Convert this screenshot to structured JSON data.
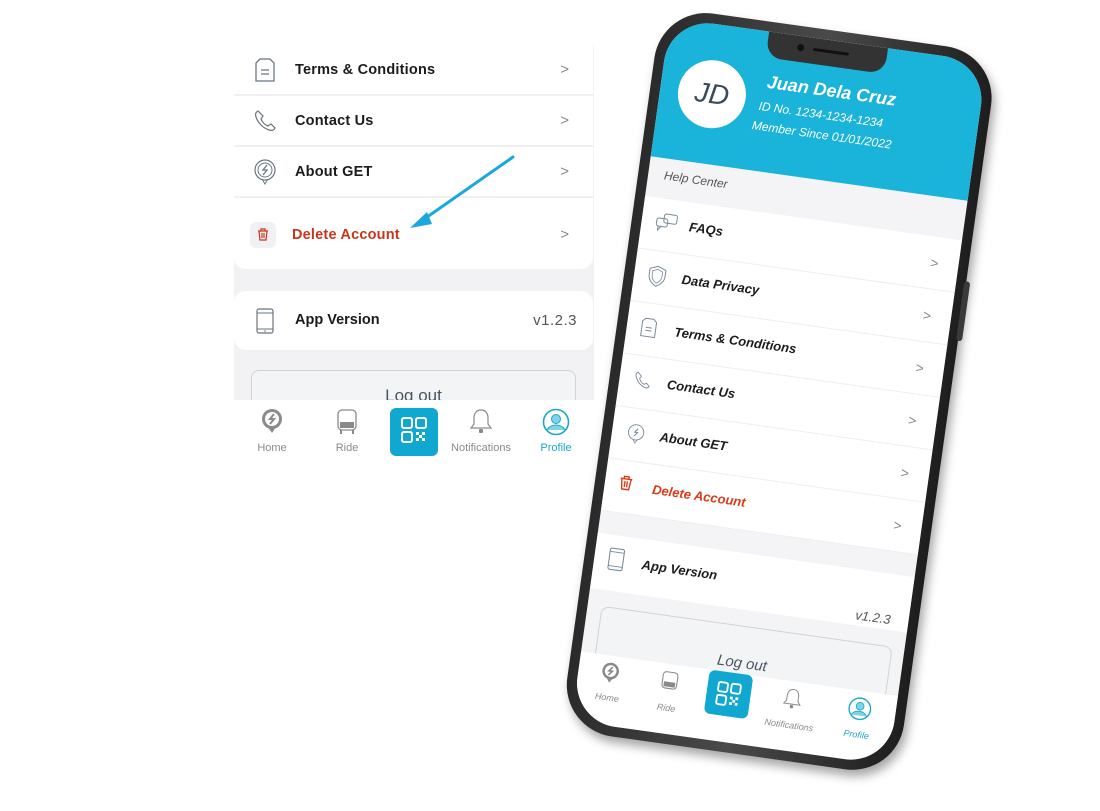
{
  "crop": {
    "menu_items": [
      {
        "label": "Terms & Conditions",
        "icon": "document-icon"
      },
      {
        "label": "Contact Us",
        "icon": "phone-icon"
      },
      {
        "label": "About GET",
        "icon": "get-logo-icon"
      },
      {
        "label": "Delete Account",
        "icon": "trash-icon"
      }
    ],
    "app_version": {
      "label": "App Version",
      "value": "v1.2.3"
    },
    "logout_label": "Log out",
    "tabs": [
      {
        "label": "Home",
        "icon": "home-get-icon"
      },
      {
        "label": "Ride",
        "icon": "bus-icon"
      },
      {
        "label": "",
        "icon": "qr-code-icon"
      },
      {
        "label": "Notifications",
        "icon": "bell-icon"
      },
      {
        "label": "Profile",
        "icon": "profile-icon",
        "active": true
      }
    ]
  },
  "phone": {
    "avatar_initials": "JD",
    "name": "Juan Dela Cruz",
    "id_no": "ID No. 1234-1234-1234",
    "member_since": "Member Since 01/01/2022",
    "section_title": "Help Center",
    "menu_items": [
      {
        "label": "FAQs",
        "icon": "faq-icon"
      },
      {
        "label": "Data Privacy",
        "icon": "shield-icon"
      },
      {
        "label": "Terms & Conditions",
        "icon": "document-icon"
      },
      {
        "label": "Contact Us",
        "icon": "phone-icon"
      },
      {
        "label": "About GET",
        "icon": "get-logo-icon"
      },
      {
        "label": "Delete Account",
        "icon": "trash-icon"
      }
    ],
    "app_version": {
      "label": "App Version",
      "value": "v1.2.3"
    },
    "logout_label": "Log out",
    "tabs": [
      {
        "label": "Home"
      },
      {
        "label": "Ride"
      },
      {
        "label": ""
      },
      {
        "label": "Notifications"
      },
      {
        "label": "Profile",
        "active": true
      }
    ]
  },
  "colors": {
    "accent": "#1ab3d9",
    "danger": "#c9351b",
    "arrow": "#1aa7e0"
  }
}
